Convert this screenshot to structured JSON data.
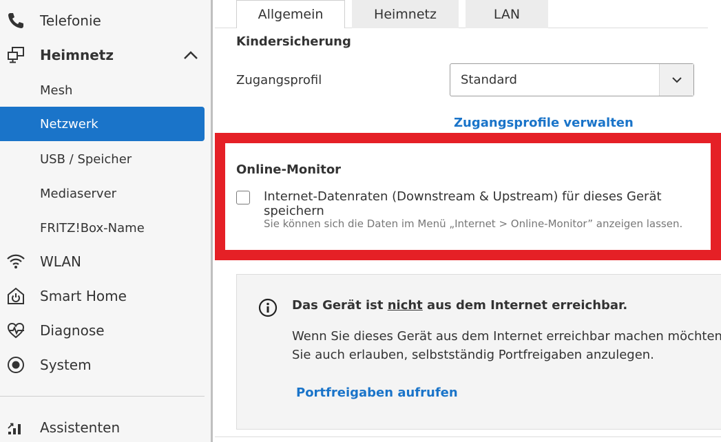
{
  "sidebar": {
    "items": [
      {
        "label": "Telefonie",
        "icon": "phone-icon"
      },
      {
        "label": "Heimnetz",
        "icon": "network-icon",
        "expanded": true
      },
      {
        "label": "Mesh"
      },
      {
        "label": "Netzwerk",
        "active": true
      },
      {
        "label": "USB / Speicher"
      },
      {
        "label": "Mediaserver"
      },
      {
        "label": "FRITZ!Box-Name"
      },
      {
        "label": "WLAN",
        "icon": "wifi-icon"
      },
      {
        "label": "Smart Home",
        "icon": "smart-home-icon"
      },
      {
        "label": "Diagnose",
        "icon": "diagnose-icon"
      },
      {
        "label": "System",
        "icon": "system-icon"
      },
      {
        "label": "Assistenten",
        "icon": "assistant-icon"
      }
    ]
  },
  "tabs": [
    {
      "label": "Allgemein",
      "active": true
    },
    {
      "label": "Heimnetz"
    },
    {
      "label": "LAN"
    }
  ],
  "kindersicherung": {
    "heading": "Kindersicherung",
    "profile_label": "Zugangsprofil",
    "profile_value": "Standard",
    "manage_link": "Zugangsprofile verwalten"
  },
  "online_monitor": {
    "heading": "Online-Monitor",
    "checkbox_label": "Internet-Datenraten (Downstream & Upstream) für dieses Gerät speichern",
    "checked": false,
    "hint": "Sie können sich die Daten im Menü „Internet > Online-Monitor” anzeigen lassen."
  },
  "info": {
    "title_before": "Das Gerät ist ",
    "title_emphasis": "nicht",
    "title_after": " aus dem Internet erreichbar.",
    "line1": "Wenn Sie dieses Gerät aus dem Internet erreichbar machen möchten, d",
    "line2": "Sie auch erlauben, selbstständig Portfreigaben anzulegen.",
    "link": "Portfreigaben aufrufen"
  },
  "colors": {
    "accent": "#1a74c9",
    "highlight": "#e52026",
    "sidebar_bg": "#f6f6f6"
  }
}
